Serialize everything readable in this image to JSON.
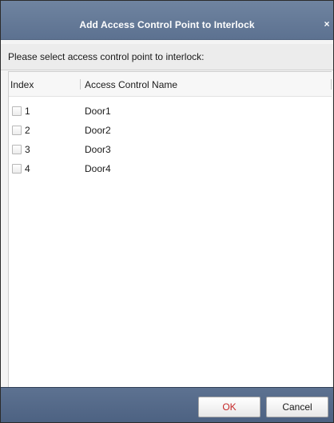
{
  "dialog": {
    "title": "Add Access Control Point to Interlock",
    "close_glyph": "×",
    "instruction": "Please select access control point to interlock:"
  },
  "table": {
    "columns": [
      "Index",
      "Access Control Name"
    ],
    "rows": [
      {
        "index": "1",
        "name": "Door1",
        "checked": false
      },
      {
        "index": "2",
        "name": "Door2",
        "checked": false
      },
      {
        "index": "3",
        "name": "Door3",
        "checked": false
      },
      {
        "index": "4",
        "name": "Door4",
        "checked": false
      }
    ]
  },
  "buttons": {
    "ok_label": "OK",
    "cancel_label": "Cancel"
  },
  "colors": {
    "titlebar": "#5c7190",
    "footer": "#4d6282",
    "ok_text": "#c62828"
  }
}
